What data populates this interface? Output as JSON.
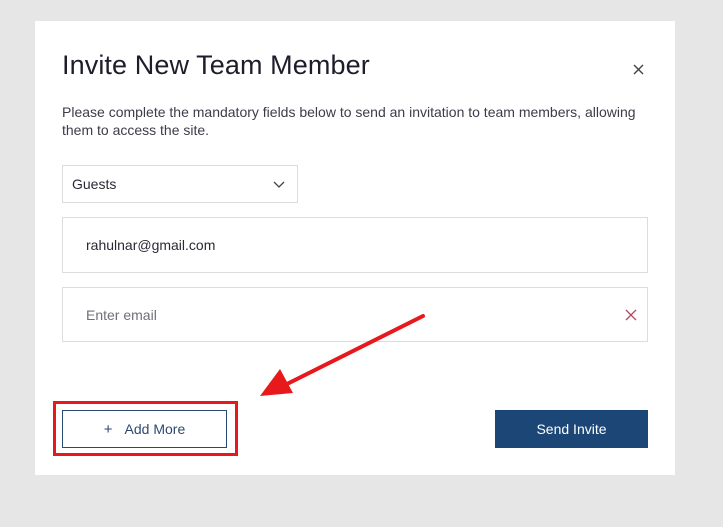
{
  "modal": {
    "title": "Invite New Team Member",
    "description": "Please complete the mandatory fields below to send an invitation to team members, allowing them to access the site.",
    "close_icon": "close-icon"
  },
  "role_select": {
    "value": "Guests",
    "icon": "chevron-down-icon"
  },
  "email_fields": [
    {
      "value": "rahulnar@gmail.com",
      "placeholder": ""
    },
    {
      "value": "",
      "placeholder": "Enter email",
      "clear_icon": "close-icon"
    }
  ],
  "actions": {
    "add_more_icon": "+",
    "add_more_label": "Add More",
    "send_label": "Send Invite"
  },
  "colors": {
    "primary": "#1b4676",
    "outline_button": "#2b4a72",
    "annotation": "#e8191c",
    "clear_icon": "#b5475f"
  }
}
